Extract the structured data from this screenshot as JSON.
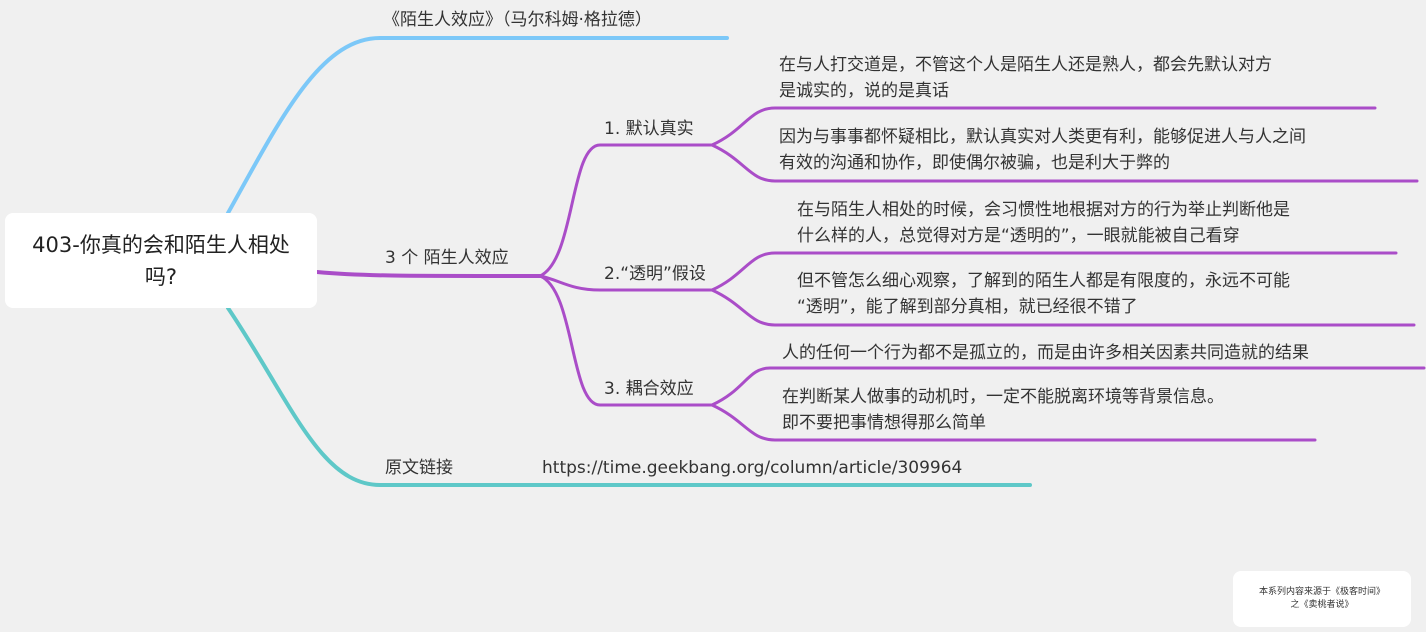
{
  "root": {
    "title": "403-你真的会和陌生人相处吗?"
  },
  "branches": {
    "book": {
      "label": "《陌生人效应》（马尔科姆·格拉德）"
    },
    "effects": {
      "label": "3 个 陌生人效应",
      "items": [
        {
          "label": "1. 默认真实",
          "notes": [
            "在与人打交道是，不管这个人是陌生人还是熟人，都会先默认对方\n是诚实的，说的是真话",
            "因为与事事都怀疑相比，默认真实对人类更有利，能够促进人与人之间\n有效的沟通和协作，即使偶尔被骗，也是利大于弊的"
          ]
        },
        {
          "label": "2.“透明”假设",
          "notes": [
            "在与陌生人相处的时候，会习惯性地根据对方的行为举止判断他是\n什么样的人，总觉得对方是“透明的”，一眼就能被自己看穿",
            "但不管怎么细心观察，了解到的陌生人都是有限度的，永远不可能\n“透明”，能了解到部分真相，就已经很不错了"
          ]
        },
        {
          "label": "3. 耦合效应",
          "notes": [
            "人的任何一个行为都不是孤立的，而是由许多相关因素共同造就的结果",
            "在判断某人做事的动机时，一定不能脱离环境等背景信息。\n即不要把事情想得那么简单"
          ]
        }
      ]
    },
    "link": {
      "label": "原文链接",
      "url": "https://time.geekbang.org/column/article/309964"
    }
  },
  "credit": {
    "line1": "本系列内容来源于《极客时间》",
    "line2": "之《卖桃者说》"
  },
  "colors": {
    "background": "#f0f0f0",
    "book_branch": "#7cc8f8",
    "effects_branch": "#aa4dc8",
    "link_branch": "#5ec8c8",
    "node_fill": "#ffffff"
  }
}
